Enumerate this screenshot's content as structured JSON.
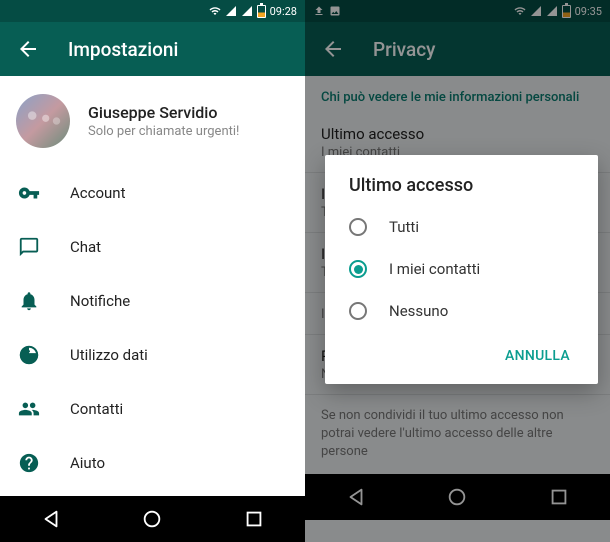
{
  "left": {
    "statusbar": {
      "time": "09:28"
    },
    "header": {
      "title": "Impostazioni"
    },
    "profile": {
      "name": "Giuseppe Servidio",
      "status": "Solo per chiamate urgenti!"
    },
    "items": [
      {
        "label": "Account"
      },
      {
        "label": "Chat"
      },
      {
        "label": "Notifiche"
      },
      {
        "label": "Utilizzo dati"
      },
      {
        "label": "Contatti"
      },
      {
        "label": "Aiuto"
      }
    ]
  },
  "right": {
    "statusbar": {
      "time": "09:35"
    },
    "header": {
      "title": "Privacy"
    },
    "section_title": "Chi può vedere le mie informazioni personali",
    "items": [
      {
        "title": "Ultimo accesso",
        "sub": "I miei contatti"
      },
      {
        "title": "I",
        "sub": "T"
      },
      {
        "title": "I",
        "sub": "T"
      },
      {
        "title": "",
        "sub": "I"
      },
      {
        "title": "Posizione attuale",
        "sub": "Nessuno"
      }
    ],
    "hint": "Se non condividi il tuo ultimo accesso non potrai vedere l'ultimo accesso delle altre persone",
    "dialog": {
      "title": "Ultimo accesso",
      "options": [
        {
          "label": "Tutti",
          "selected": false
        },
        {
          "label": "I miei contatti",
          "selected": true
        },
        {
          "label": "Nessuno",
          "selected": false
        }
      ],
      "cancel": "ANNULLA"
    }
  }
}
